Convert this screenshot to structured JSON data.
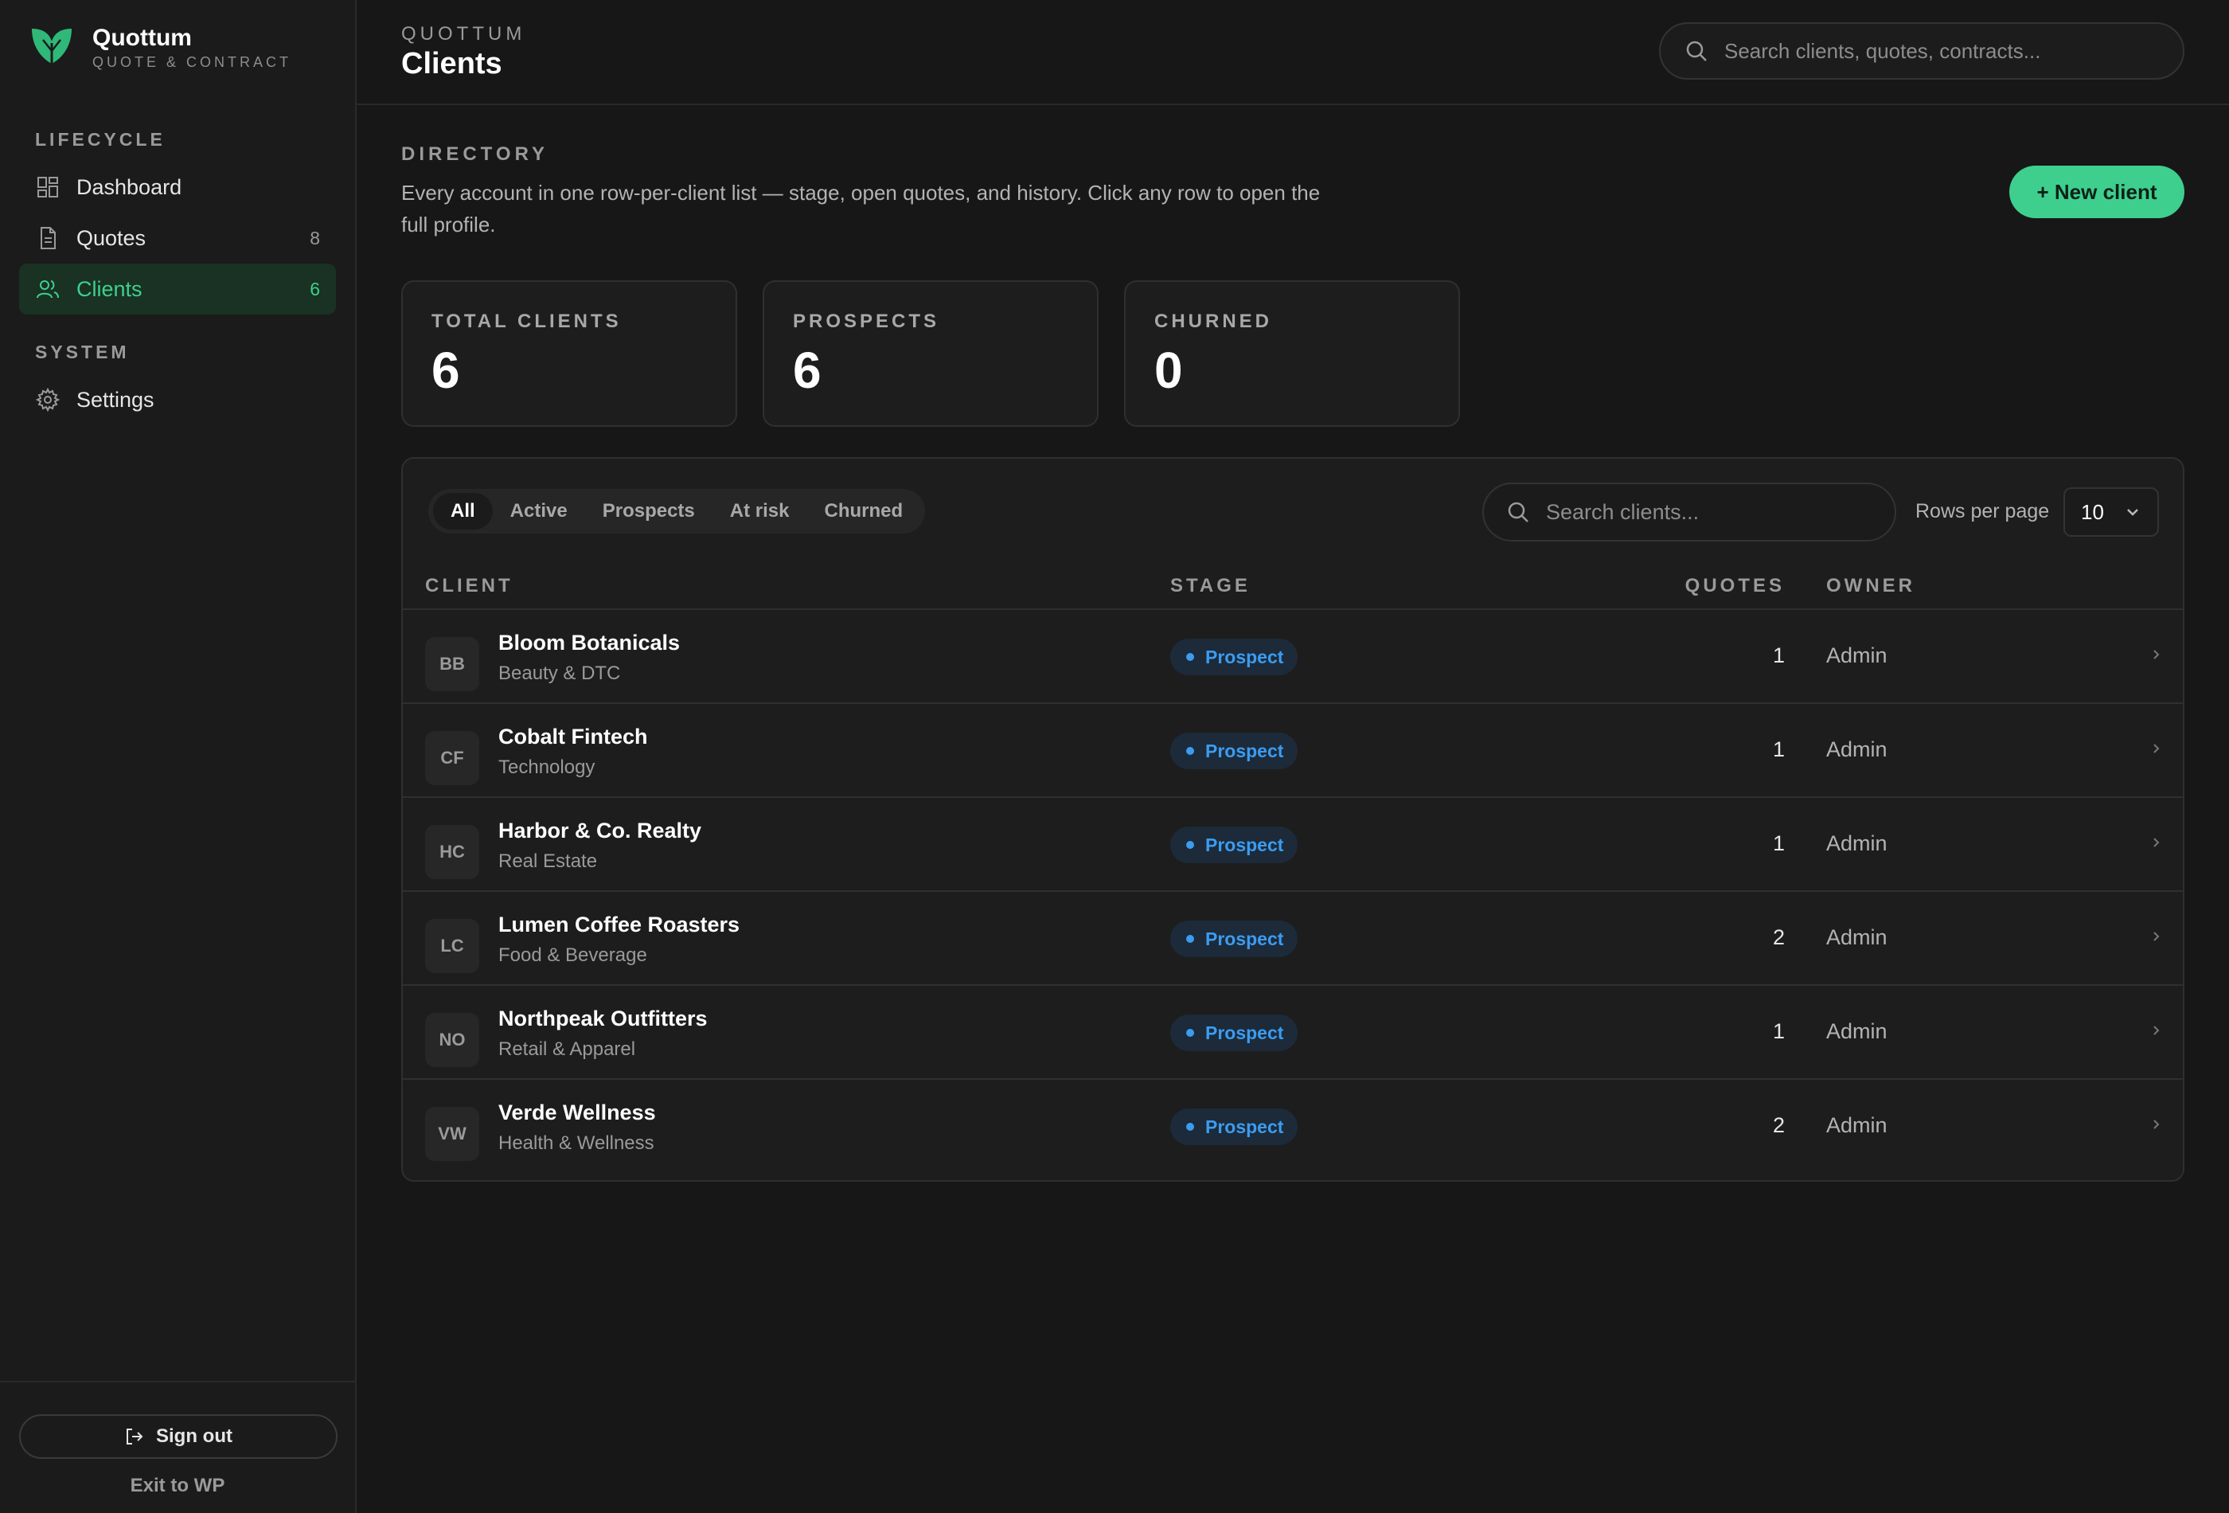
{
  "brand": {
    "name": "Quottum",
    "subtitle": "QUOTE & CONTRACT"
  },
  "sidebar": {
    "sections": [
      {
        "heading": "LIFECYCLE",
        "items": [
          {
            "label": "Dashboard",
            "icon": "dashboard-icon",
            "count": ""
          },
          {
            "label": "Quotes",
            "icon": "document-icon",
            "count": "8"
          },
          {
            "label": "Clients",
            "icon": "users-icon",
            "count": "6",
            "active": true
          }
        ]
      },
      {
        "heading": "SYSTEM",
        "items": [
          {
            "label": "Settings",
            "icon": "gear-icon",
            "count": ""
          }
        ]
      }
    ],
    "signout_label": "Sign out",
    "exit_label": "Exit to WP"
  },
  "header": {
    "eyebrow": "QUOTTUM",
    "title": "Clients",
    "search_placeholder": "Search clients, quotes, contracts..."
  },
  "directory": {
    "eyebrow": "DIRECTORY",
    "description": "Every account in one row-per-client list — stage, open quotes, and history. Click any row to open the full profile.",
    "new_client_label": "+ New client"
  },
  "stats": [
    {
      "label": "TOTAL CLIENTS",
      "value": "6"
    },
    {
      "label": "PROSPECTS",
      "value": "6"
    },
    {
      "label": "CHURNED",
      "value": "0"
    }
  ],
  "table": {
    "filters": [
      "All",
      "Active",
      "Prospects",
      "At risk",
      "Churned"
    ],
    "active_filter": "All",
    "search_placeholder": "Search clients...",
    "rows_per_page_label": "Rows per page",
    "rows_per_page_value": "10",
    "columns": {
      "client": "CLIENT",
      "stage": "STAGE",
      "quotes": "QUOTES",
      "owner": "OWNER"
    },
    "rows": [
      {
        "initials": "BB",
        "name": "Bloom Botanicals",
        "industry": "Beauty & DTC",
        "stage": "Prospect",
        "quotes": "1",
        "owner": "Admin"
      },
      {
        "initials": "CF",
        "name": "Cobalt Fintech",
        "industry": "Technology",
        "stage": "Prospect",
        "quotes": "1",
        "owner": "Admin"
      },
      {
        "initials": "HC",
        "name": "Harbor & Co. Realty",
        "industry": "Real Estate",
        "stage": "Prospect",
        "quotes": "1",
        "owner": "Admin"
      },
      {
        "initials": "LC",
        "name": "Lumen Coffee Roasters",
        "industry": "Food & Beverage",
        "stage": "Prospect",
        "quotes": "2",
        "owner": "Admin"
      },
      {
        "initials": "NO",
        "name": "Northpeak Outfitters",
        "industry": "Retail & Apparel",
        "stage": "Prospect",
        "quotes": "1",
        "owner": "Admin"
      },
      {
        "initials": "VW",
        "name": "Verde Wellness",
        "industry": "Health & Wellness",
        "stage": "Prospect",
        "quotes": "2",
        "owner": "Admin"
      }
    ]
  },
  "colors": {
    "accent": "#3ecf8e",
    "prospect": "#3b9cf0",
    "background": "#171717"
  }
}
